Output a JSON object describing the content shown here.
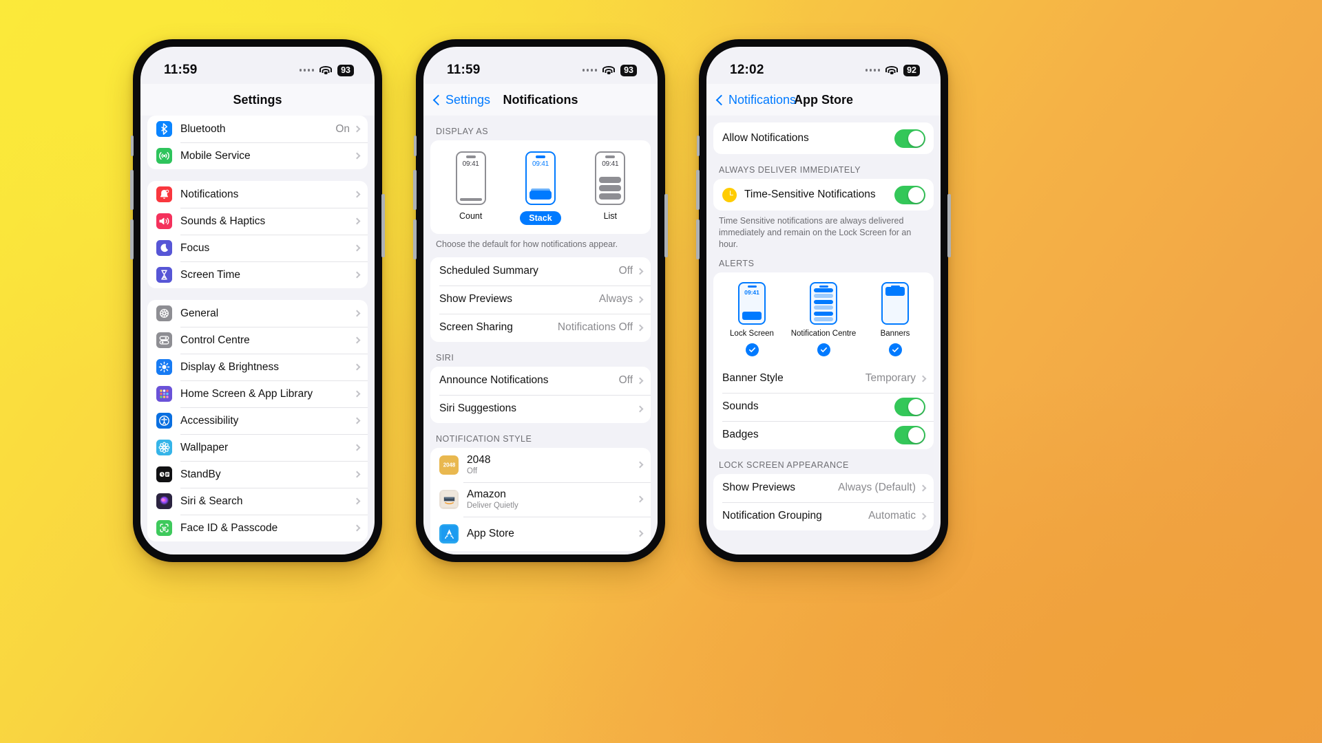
{
  "colors": {
    "accent": "#007aff",
    "green": "#34c759",
    "grey": "#8a8a8e"
  },
  "phone1": {
    "status": {
      "time": "11:59",
      "battery": "93"
    },
    "nav": {
      "title": "Settings"
    },
    "groups": [
      {
        "rows": [
          {
            "label": "Bluetooth",
            "value": "On",
            "icon": "bluetooth-icon",
            "chevron": true
          },
          {
            "label": "Mobile Service",
            "value": "",
            "icon": "mobile-service-icon",
            "chevron": true
          }
        ]
      },
      {
        "rows": [
          {
            "label": "Notifications",
            "value": "",
            "icon": "notifications-icon",
            "chevron": true
          },
          {
            "label": "Sounds & Haptics",
            "value": "",
            "icon": "sounds-haptics-icon",
            "chevron": true
          },
          {
            "label": "Focus",
            "value": "",
            "icon": "focus-icon",
            "chevron": true
          },
          {
            "label": "Screen Time",
            "value": "",
            "icon": "screen-time-icon",
            "chevron": true
          }
        ]
      },
      {
        "rows": [
          {
            "label": "General",
            "value": "",
            "icon": "general-icon",
            "chevron": true
          },
          {
            "label": "Control Centre",
            "value": "",
            "icon": "control-centre-icon",
            "chevron": true
          },
          {
            "label": "Display & Brightness",
            "value": "",
            "icon": "display-brightness-icon",
            "chevron": true
          },
          {
            "label": "Home Screen & App Library",
            "value": "",
            "icon": "home-screen-icon",
            "chevron": true
          },
          {
            "label": "Accessibility",
            "value": "",
            "icon": "accessibility-icon",
            "chevron": true
          },
          {
            "label": "Wallpaper",
            "value": "",
            "icon": "wallpaper-icon",
            "chevron": true
          },
          {
            "label": "StandBy",
            "value": "",
            "icon": "standby-icon",
            "chevron": true
          },
          {
            "label": "Siri & Search",
            "value": "",
            "icon": "siri-search-icon",
            "chevron": true
          },
          {
            "label": "Face ID & Passcode",
            "value": "",
            "icon": "face-id-icon",
            "chevron": true
          }
        ]
      }
    ]
  },
  "phone2": {
    "status": {
      "time": "11:59",
      "battery": "93"
    },
    "nav": {
      "back": "Settings",
      "title": "Notifications"
    },
    "display_as": {
      "header": "DISPLAY AS",
      "footer": "Choose the default for how notifications appear.",
      "options": [
        {
          "label": "Count",
          "selected": false,
          "mini_time": "09:41"
        },
        {
          "label": "Stack",
          "selected": true,
          "mini_time": "09:41"
        },
        {
          "label": "List",
          "selected": false,
          "mini_time": "09:41"
        }
      ]
    },
    "main_rows": [
      {
        "label": "Scheduled Summary",
        "value": "Off"
      },
      {
        "label": "Show Previews",
        "value": "Always"
      },
      {
        "label": "Screen Sharing",
        "value": "Notifications Off"
      }
    ],
    "siri": {
      "header": "SIRI",
      "rows": [
        {
          "label": "Announce Notifications",
          "value": "Off"
        },
        {
          "label": "Siri Suggestions",
          "value": ""
        }
      ]
    },
    "notification_style": {
      "header": "NOTIFICATION STYLE",
      "apps": [
        {
          "name": "2048",
          "status": "Off",
          "icon": "app-2048-icon"
        },
        {
          "name": "Amazon",
          "status": "Deliver Quietly",
          "icon": "app-amazon-icon"
        },
        {
          "name": "App Store",
          "status": "",
          "icon": "app-store-icon"
        }
      ]
    }
  },
  "phone3": {
    "status": {
      "time": "12:02",
      "battery": "92"
    },
    "nav": {
      "back": "Notifications",
      "title": "App Store"
    },
    "allow": {
      "label": "Allow Notifications",
      "on": true
    },
    "always_deliver": {
      "header": "ALWAYS DELIVER IMMEDIATELY",
      "row": {
        "label": "Time-Sensitive Notifications",
        "on": true
      },
      "footer": "Time Sensitive notifications are always delivered immediately and remain on the Lock Screen for an hour."
    },
    "alerts": {
      "header": "ALERTS",
      "options": [
        {
          "label": "Lock Screen",
          "checked": true,
          "mini_time": "09:41"
        },
        {
          "label": "Notification Centre",
          "checked": true,
          "mini_time": ""
        },
        {
          "label": "Banners",
          "checked": true,
          "mini_time": ""
        }
      ],
      "rows": [
        {
          "label": "Banner Style",
          "value": "Temporary",
          "type": "chevron"
        },
        {
          "label": "Sounds",
          "value": "",
          "type": "toggle",
          "on": true
        },
        {
          "label": "Badges",
          "value": "",
          "type": "toggle",
          "on": true
        }
      ]
    },
    "lock_screen_appearance": {
      "header": "LOCK SCREEN APPEARANCE",
      "rows": [
        {
          "label": "Show Previews",
          "value": "Always (Default)"
        },
        {
          "label": "Notification Grouping",
          "value": "Automatic"
        }
      ]
    }
  }
}
